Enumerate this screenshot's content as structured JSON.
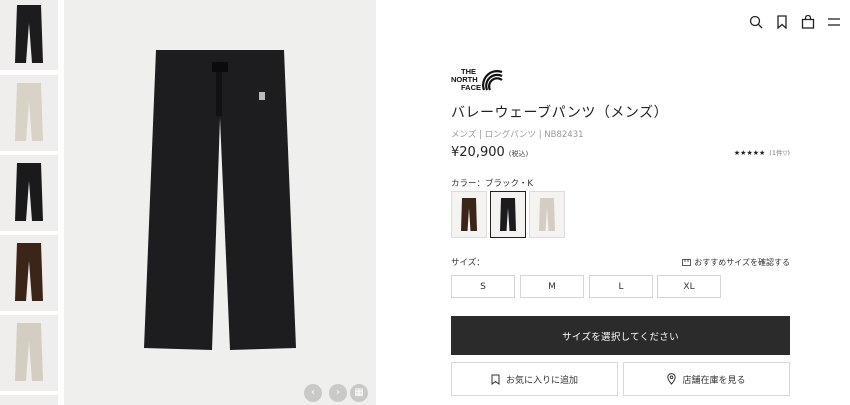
{
  "header": {
    "icons": [
      "search-icon",
      "bookmark-icon",
      "bag-icon",
      "menu-icon"
    ]
  },
  "gallery": {
    "thumbnails": [
      {
        "color": "#1c1c1e"
      },
      {
        "color": "#d8d2c7"
      },
      {
        "color": "#1a1a1c"
      },
      {
        "color": "#3b2418"
      },
      {
        "color": "#d4cdc2"
      }
    ],
    "main_color": "#1d1d20",
    "controls": {
      "prev": "‹",
      "next": "›",
      "grid": "▦"
    }
  },
  "product": {
    "brand_line1": "THE",
    "brand_line2": "NORTH",
    "brand_line3": "FACE",
    "title": "バレーウェーブパンツ（メンズ）",
    "meta": "メンズ | ロングパンツ | NB82431",
    "price": "¥20,900",
    "price_tax": "(税込)",
    "rating_stars": "★★★★★",
    "rating_count": "(1件▽)",
    "color_label": "カラー：ブラック・K",
    "swatches": [
      {
        "color": "#3b2418",
        "selected": false
      },
      {
        "color": "#1c1c1e",
        "selected": true
      },
      {
        "color": "#d4cdc2",
        "selected": false
      }
    ],
    "size_label": "サイズ：",
    "size_guide": "おすすめサイズを確認する",
    "sizes": [
      "S",
      "M",
      "L",
      "XL"
    ],
    "cta": "サイズを選択してください",
    "favorite": "お気に入りに追加",
    "store_stock": "店舗在庫を見る"
  }
}
